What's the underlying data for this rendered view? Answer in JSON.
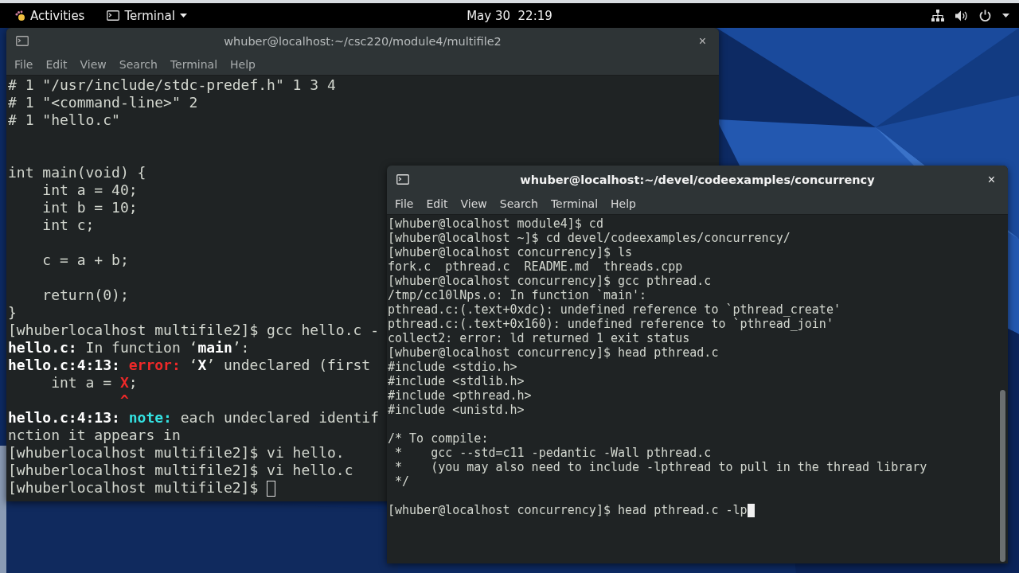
{
  "top_bar": {
    "activities": "Activities",
    "app_menu": "Terminal",
    "clock": "May 30  22:19"
  },
  "windows": [
    {
      "title": "whuber@localhost:~/csc220/module4/multifile2",
      "close": "×",
      "focused": false,
      "menu": [
        "File",
        "Edit",
        "View",
        "Search",
        "Terminal",
        "Help"
      ],
      "lines": [
        {
          "kind": "plain",
          "text": "# 1 \"/usr/include/stdc-predef.h\" 1 3 4"
        },
        {
          "kind": "plain",
          "text": "# 1 \"<command-line>\" 2"
        },
        {
          "kind": "plain",
          "text": "# 1 \"hello.c\""
        },
        {
          "kind": "blank"
        },
        {
          "kind": "blank"
        },
        {
          "kind": "plain",
          "text": "int main(void) {"
        },
        {
          "kind": "plain",
          "text": "    int a = 40;"
        },
        {
          "kind": "plain",
          "text": "    int b = 10;"
        },
        {
          "kind": "plain",
          "text": "    int c;"
        },
        {
          "kind": "blank"
        },
        {
          "kind": "plain",
          "text": "    c = a + b;"
        },
        {
          "kind": "blank"
        },
        {
          "kind": "plain",
          "text": "    return(0);"
        },
        {
          "kind": "plain",
          "text": "}"
        },
        {
          "kind": "plain",
          "text": "[whuberlocalhost multifile2]$ gcc hello.c -"
        },
        {
          "kind": "rich",
          "segments": [
            {
              "kind": "bold",
              "text": "hello.c:"
            },
            {
              "kind": "plain",
              "text": " In function ‘"
            },
            {
              "kind": "bold",
              "text": "main"
            },
            {
              "kind": "plain",
              "text": "’:"
            }
          ]
        },
        {
          "kind": "rich",
          "segments": [
            {
              "kind": "bold",
              "text": "hello.c:4:13:"
            },
            {
              "kind": "error",
              "text": " error:"
            },
            {
              "kind": "plain",
              "text": " ‘"
            },
            {
              "kind": "bold",
              "text": "X"
            },
            {
              "kind": "plain",
              "text": "’ undeclared (first"
            }
          ]
        },
        {
          "kind": "rich",
          "segments": [
            {
              "kind": "plain",
              "text": "     int a = "
            },
            {
              "kind": "error",
              "text": "X"
            },
            {
              "kind": "plain",
              "text": ";"
            }
          ]
        },
        {
          "kind": "rich",
          "segments": [
            {
              "kind": "error",
              "text": "             ^"
            }
          ]
        },
        {
          "kind": "rich",
          "segments": [
            {
              "kind": "bold",
              "text": "hello.c:4:13:"
            },
            {
              "kind": "note",
              "text": " note:"
            },
            {
              "kind": "plain",
              "text": " each undeclared identif"
            }
          ]
        },
        {
          "kind": "plain",
          "text": "nction it appears in"
        },
        {
          "kind": "plain",
          "text": "[whuberlocalhost multifile2]$ vi hello."
        },
        {
          "kind": "plain",
          "text": "[whuberlocalhost multifile2]$ vi hello.c"
        },
        {
          "kind": "plain",
          "text": "[whuberlocalhost multifile2]$ "
        }
      ]
    },
    {
      "title": "whuber@localhost:~/devel/codeexamples/concurrency",
      "close": "×",
      "focused": true,
      "menu": [
        "File",
        "Edit",
        "View",
        "Search",
        "Terminal",
        "Help"
      ],
      "lines": [
        {
          "kind": "plain",
          "text": "[whuber@localhost module4]$ cd"
        },
        {
          "kind": "plain",
          "text": "[whuber@localhost ~]$ cd devel/codeexamples/concurrency/"
        },
        {
          "kind": "plain",
          "text": "[whuber@localhost concurrency]$ ls"
        },
        {
          "kind": "plain",
          "text": "fork.c  pthread.c  README.md  threads.cpp"
        },
        {
          "kind": "plain",
          "text": "[whuber@localhost concurrency]$ gcc pthread.c"
        },
        {
          "kind": "plain",
          "text": "/tmp/cc10lNps.o: In function `main':"
        },
        {
          "kind": "plain",
          "text": "pthread.c:(.text+0xdc): undefined reference to `pthread_create'"
        },
        {
          "kind": "plain",
          "text": "pthread.c:(.text+0x160): undefined reference to `pthread_join'"
        },
        {
          "kind": "plain",
          "text": "collect2: error: ld returned 1 exit status"
        },
        {
          "kind": "plain",
          "text": "[whuber@localhost concurrency]$ head pthread.c"
        },
        {
          "kind": "plain",
          "text": "#include <stdio.h>"
        },
        {
          "kind": "plain",
          "text": "#include <stdlib.h>"
        },
        {
          "kind": "plain",
          "text": "#include <pthread.h>"
        },
        {
          "kind": "plain",
          "text": "#include <unistd.h>"
        },
        {
          "kind": "blank"
        },
        {
          "kind": "plain",
          "text": "/* To compile:"
        },
        {
          "kind": "plain",
          "text": " *    gcc --std=c11 -pedantic -Wall pthread.c"
        },
        {
          "kind": "plain",
          "text": " *    (you may also need to include -lpthread to pull in the thread library"
        },
        {
          "kind": "plain",
          "text": " */"
        },
        {
          "kind": "blank"
        },
        {
          "kind": "plain",
          "text": "[whuber@localhost concurrency]$ head pthread.c -lp"
        }
      ]
    }
  ]
}
